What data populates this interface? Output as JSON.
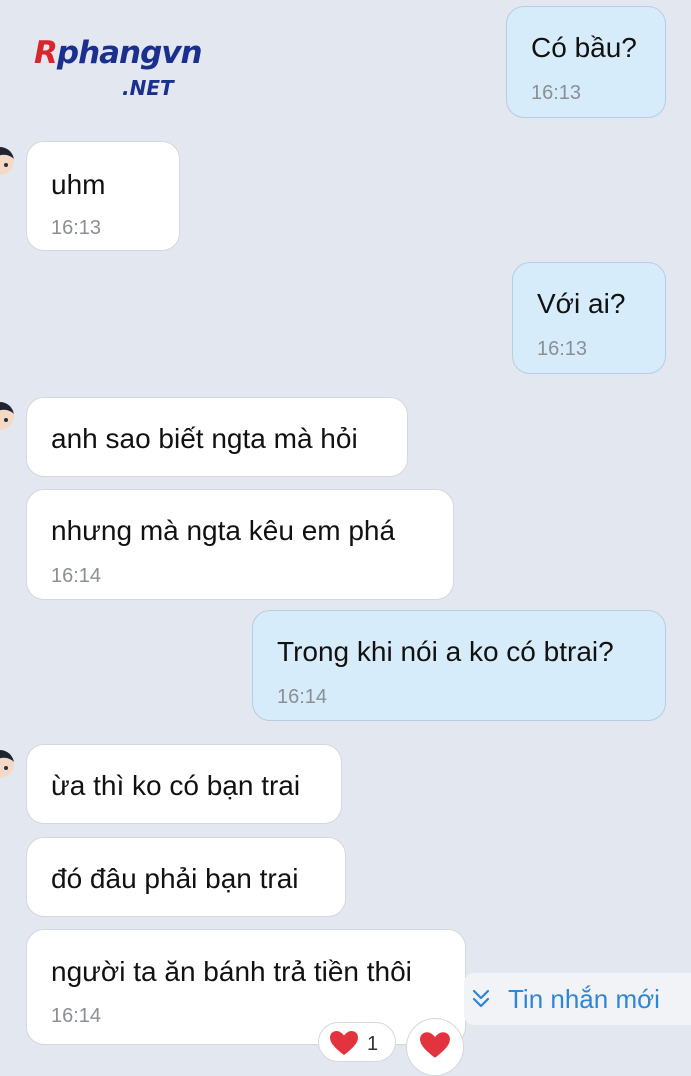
{
  "watermark": {
    "brand_main": "Rphangvn",
    "brand_first_letter": "R",
    "brand_rest": "phangvn",
    "brand_suffix": ".NET"
  },
  "colors": {
    "background": "#e3e7f0",
    "incoming_bubble": "#ffffff",
    "outgoing_bubble": "#d7ecfa",
    "accent": "#2f86d6",
    "reaction_heart": "#e3333e"
  },
  "messages": [
    {
      "direction": "out",
      "text": "Có bầu?",
      "time": "16:13"
    },
    {
      "direction": "in",
      "text": "uhm",
      "time": "16:13",
      "avatar": true
    },
    {
      "direction": "out",
      "text": "Với ai?",
      "time": "16:13"
    },
    {
      "direction": "in",
      "text": "anh sao biết ngta mà hỏi",
      "time": "",
      "avatar": true
    },
    {
      "direction": "in",
      "text": "nhưng mà ngta kêu em phá",
      "time": "16:14"
    },
    {
      "direction": "out",
      "text": "Trong khi nói a ko có btrai?",
      "time": "16:14"
    },
    {
      "direction": "in",
      "text": "ừa thì ko có bạn trai",
      "time": "",
      "avatar": true
    },
    {
      "direction": "in",
      "text": "đó đâu phải bạn trai",
      "time": ""
    },
    {
      "direction": "in",
      "text": "người ta ăn bánh trả tiền thôi",
      "time": "16:14"
    }
  ],
  "new_messages_button": {
    "label": "Tin nhắn mới",
    "icon": "double-chevron-down-icon"
  },
  "reactions": {
    "icon": "heart-icon",
    "count": "1"
  }
}
